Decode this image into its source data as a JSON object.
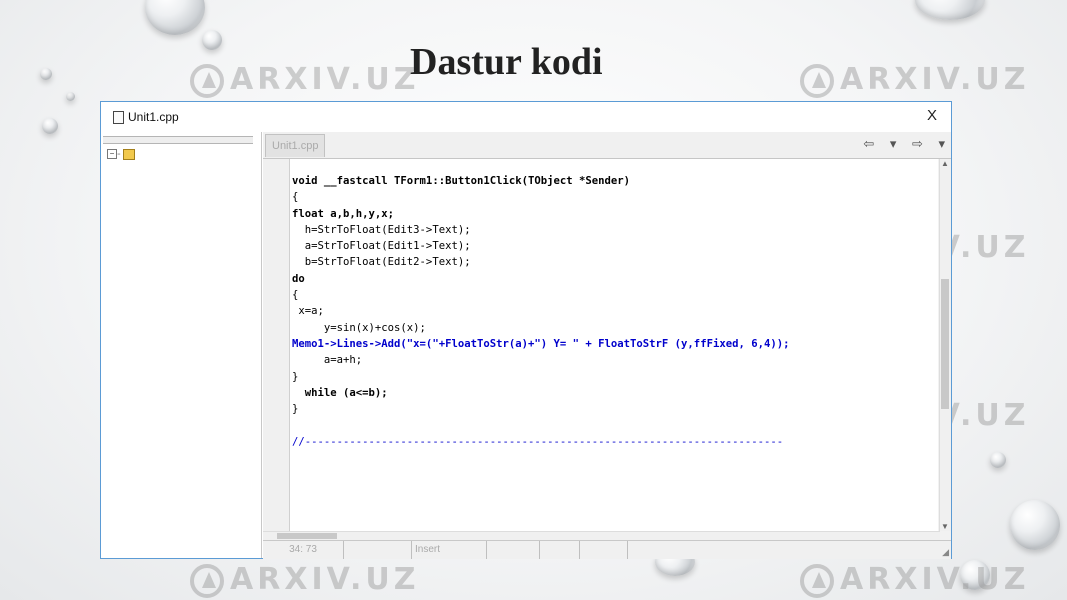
{
  "slide": {
    "title": "Dastur kodi",
    "watermark": "ARXIV.UZ"
  },
  "window": {
    "file_name": "Unit1.cpp",
    "close_glyph": "X"
  },
  "editor": {
    "tab_label": "Unit1.cpp",
    "nav_glyphs": "⇦ ▾ ⇨ ▾",
    "code_lines": [
      "void __fastcall TForm1::Button1Click(TObject *Sender)",
      "{",
      "float a,b,h,y,x;",
      "  h=StrToFloat(Edit3->Text);",
      "  a=StrToFloat(Edit1->Text);",
      "  b=StrToFloat(Edit2->Text);",
      "do",
      "{",
      " x=a;",
      "     y=sin(x)+cos(x);",
      "Memo1->Lines->Add(\"x=(\"+FloatToStr(a)+\") Y= \" + FloatToStrF (y,ffFixed, 6,4));",
      "     a=a+h;",
      "}",
      "  while (a<=b);",
      "}",
      "//---------------------------------------------------------------------------"
    ]
  },
  "status": {
    "position": "34: 73",
    "mode": "Insert"
  },
  "colors": {
    "window_border": "#5b9bd5",
    "string_literal": "#0000cc"
  }
}
